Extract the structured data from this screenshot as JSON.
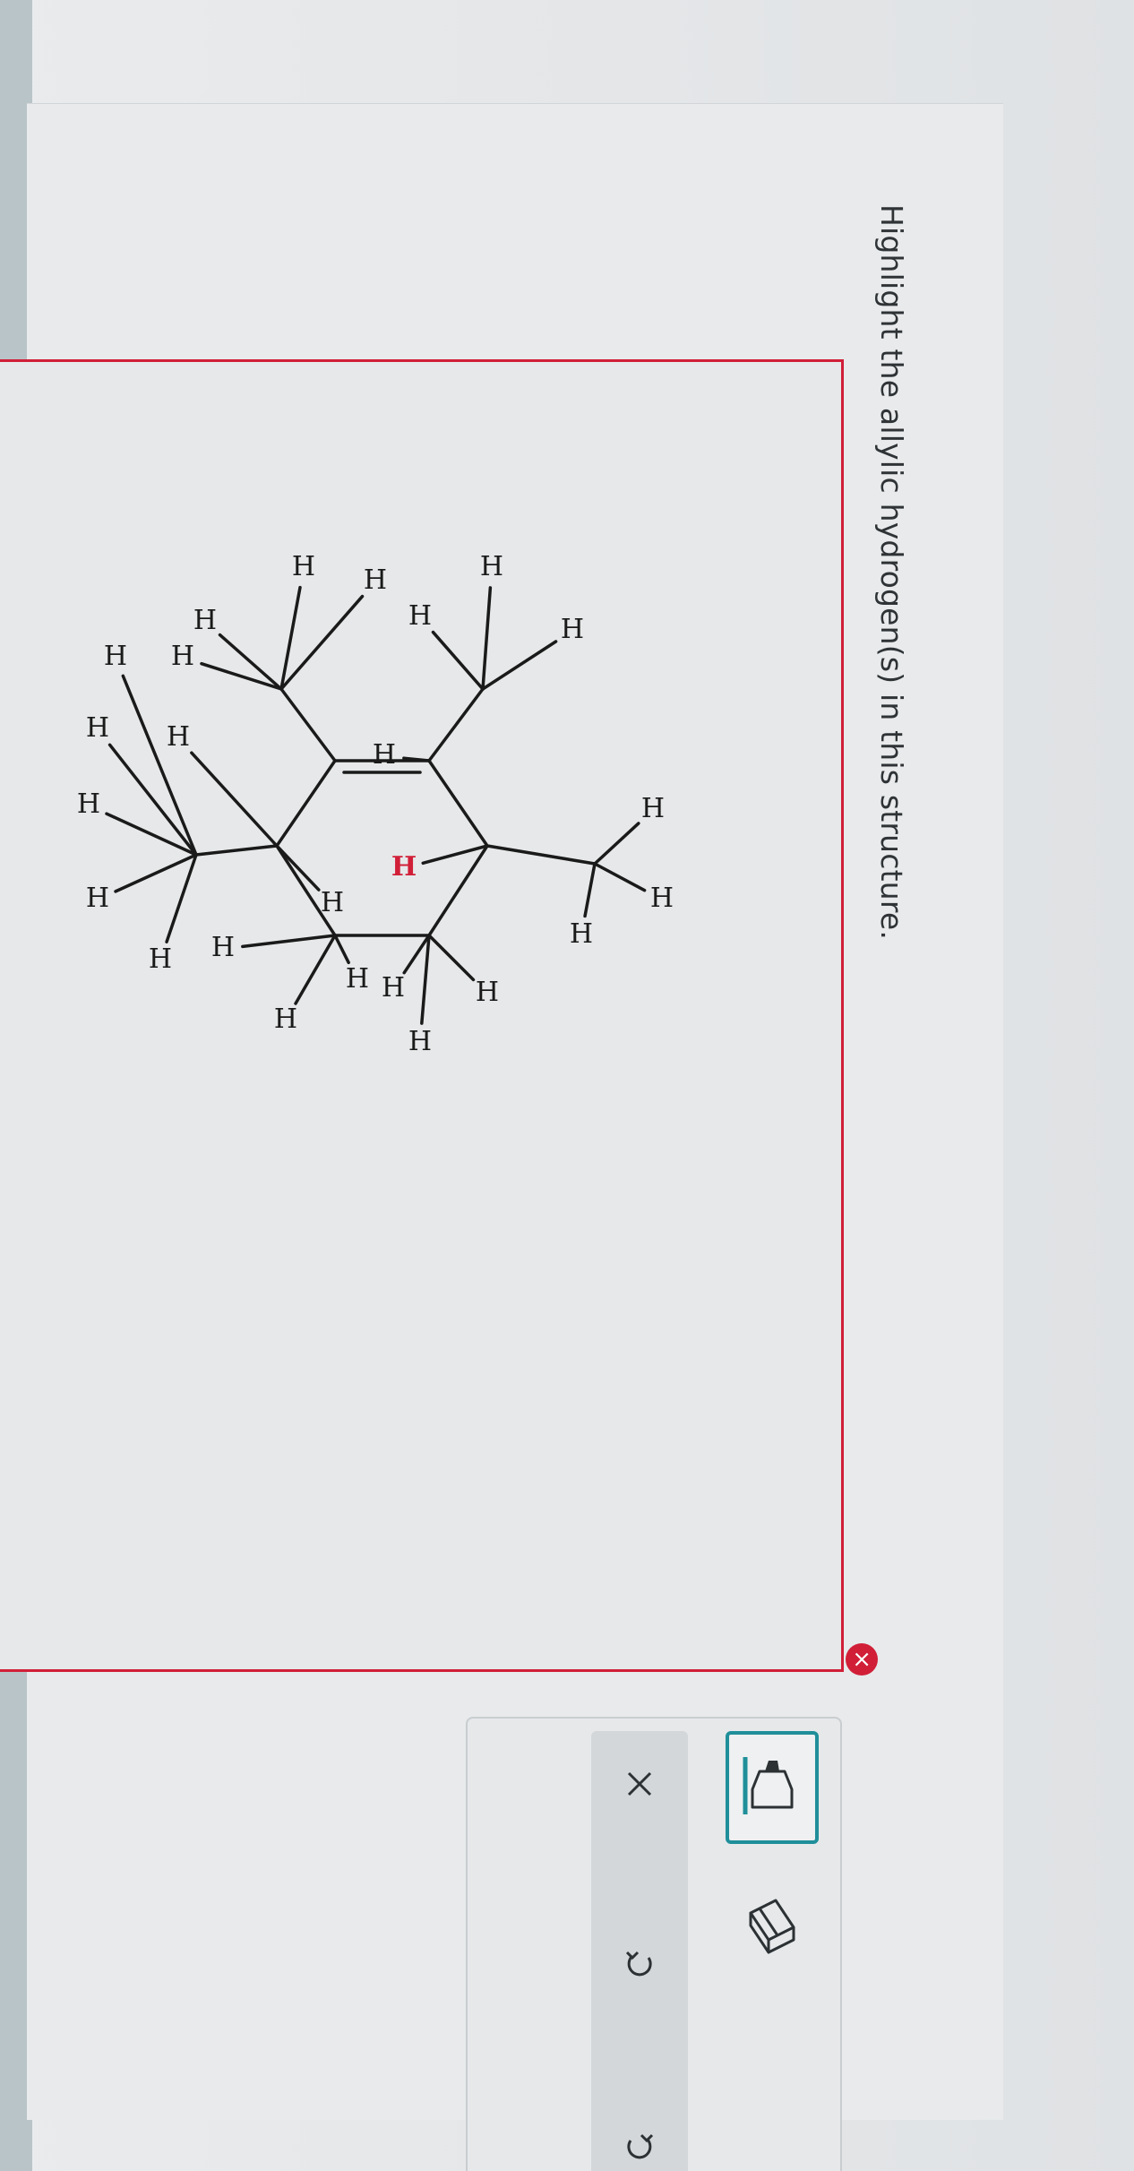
{
  "question": {
    "prompt": "Highlight the allylic hydrogen(s) in this structure."
  },
  "canvas": {
    "state": "incorrect",
    "border_color": "#d11f38",
    "error_icon": "x-circle-icon"
  },
  "molecule": {
    "atom_label": "H",
    "highlight_color": "#d11f38",
    "bond_color": "#1a1a1a",
    "highlighted_count": 1
  },
  "toolbar": {
    "tools": [
      {
        "name": "highlighter-tool",
        "icon": "marker-icon",
        "active": true
      },
      {
        "name": "eraser-tool",
        "icon": "eraser-icon",
        "active": false
      }
    ],
    "actions": [
      {
        "name": "clear-button",
        "icon": "close-icon"
      },
      {
        "name": "undo-button",
        "icon": "undo-icon"
      },
      {
        "name": "redo-button",
        "icon": "redo-icon"
      }
    ],
    "accent_color": "#1f8f9a"
  }
}
